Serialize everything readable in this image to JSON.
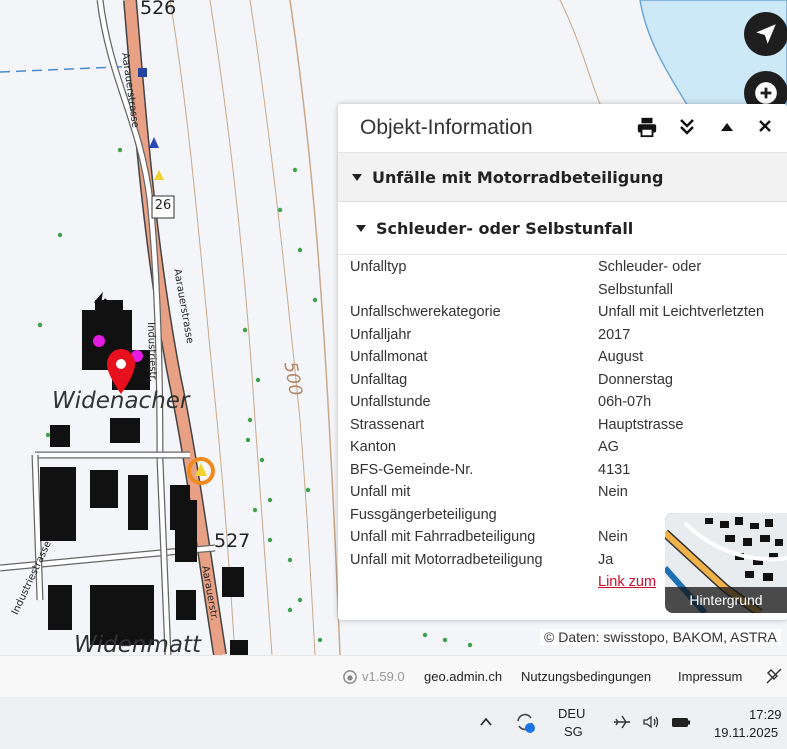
{
  "map": {
    "place_labels": [
      "Widenacher",
      "Widenmatt"
    ],
    "road_labels": [
      "Aarauerstrasse",
      "Industriestr.",
      "Industriestrasse",
      "Aarauerstr."
    ],
    "route_number": "26",
    "elevations": [
      "526",
      "500",
      "527"
    ],
    "attribution": "© Daten: swisstopo, BAKOM, ASTRA"
  },
  "controls": {
    "locate": "navigation-arrow-icon",
    "zoom_in": "plus-icon",
    "zoom_out": "minus-icon",
    "view_3d": "cube-icon",
    "history": "time-history-icon"
  },
  "panel": {
    "title": "Objekt-Information",
    "section": "Unfälle mit Motorradbeteiligung",
    "feature": "Schleuder- oder Selbstunfall",
    "rows": [
      {
        "k": "Unfalltyp",
        "v": "Schleuder- oder Selbstunfall"
      },
      {
        "k": "Unfallschwerekategorie",
        "v": "Unfall mit Leichtverletzten"
      },
      {
        "k": "Unfalljahr",
        "v": "2017"
      },
      {
        "k": "Unfallmonat",
        "v": "August"
      },
      {
        "k": "Unfalltag",
        "v": "Donnerstag"
      },
      {
        "k": "Unfallstunde",
        "v": "06h-07h"
      },
      {
        "k": "Strassenart",
        "v": "Hauptstrasse"
      },
      {
        "k": "Kanton",
        "v": "AG"
      },
      {
        "k": "BFS-Gemeinde-Nr.",
        "v": "4131"
      },
      {
        "k": "Unfall mit Fussgängerbeteiligung",
        "v": "Nein"
      },
      {
        "k": "Unfall mit Fahrradbeteiligung",
        "v": "Nein"
      },
      {
        "k": "Unfall mit Motorradbeteiligung",
        "v": "Ja"
      }
    ],
    "link": "Link zum"
  },
  "background_switcher": {
    "label": "Hintergrund"
  },
  "footer": {
    "version": "v1.59.0",
    "site": "geo.admin.ch",
    "terms": "Nutzungsbedingungen",
    "imprint": "Impressum"
  },
  "taskbar": {
    "lang": "DEU",
    "region": "SG",
    "time": "17:29",
    "date": "19.11.2025"
  }
}
